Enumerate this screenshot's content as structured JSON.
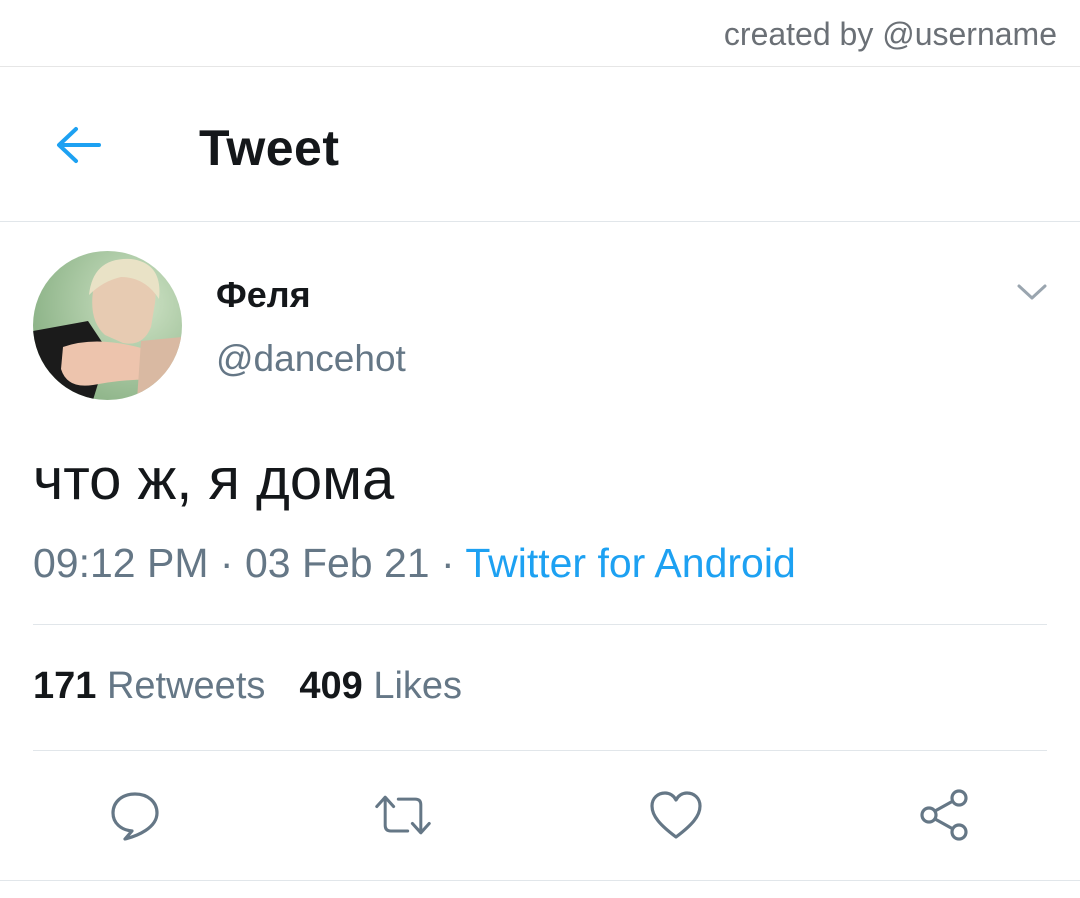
{
  "credit": "created by @username",
  "header": {
    "title": "Tweet",
    "back_icon": "arrow-left-icon",
    "accent": "#1da1f2"
  },
  "tweet": {
    "display_name": "Феля",
    "handle": "@dancehot",
    "text": "что ж, я дома",
    "time": "09:12 PM",
    "sep1": "·",
    "date": "03 Feb 21",
    "sep2": "·",
    "source": "Twitter for Android"
  },
  "stats": {
    "retweets_count": "171",
    "retweets_label": "Retweets",
    "likes_count": "409",
    "likes_label": "Likes"
  },
  "actions": [
    {
      "name": "reply",
      "icon": "speech-bubble-icon"
    },
    {
      "name": "retweet",
      "icon": "retweet-icon"
    },
    {
      "name": "like",
      "icon": "heart-icon"
    },
    {
      "name": "share",
      "icon": "share-icon"
    }
  ],
  "colors": {
    "text": "#14171a",
    "secondary": "#657786",
    "link": "#1da1f2",
    "divider": "#e1e6ea"
  }
}
